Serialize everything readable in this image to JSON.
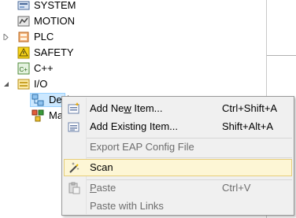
{
  "tree": {
    "items": [
      {
        "label": "SYSTEM",
        "icon": "system-icon"
      },
      {
        "label": "MOTION",
        "icon": "motion-icon"
      },
      {
        "label": "PLC",
        "icon": "plc-icon"
      },
      {
        "label": "SAFETY",
        "icon": "safety-icon"
      },
      {
        "label": "C++",
        "icon": "cpp-icon"
      },
      {
        "label": "I/O",
        "icon": "io-icon"
      },
      {
        "label": "Devi",
        "icon": "devices-icon"
      },
      {
        "label": "Ma",
        "icon": "mappings-icon"
      }
    ]
  },
  "context_menu": {
    "items": [
      {
        "pre": "Add Ne",
        "ul": "w",
        "post": " Item...",
        "shortcut": "Ctrl+Shift+A",
        "enabled": true,
        "icon": "add-new-item-icon"
      },
      {
        "pre": "Add Existing Item...",
        "ul": "",
        "post": "",
        "shortcut": "Shift+Alt+A",
        "enabled": true,
        "icon": "add-existing-item-icon"
      },
      {
        "pre": "Export EAP Config File",
        "ul": "",
        "post": "",
        "shortcut": "",
        "enabled": false,
        "icon": ""
      },
      {
        "pre": "Scan",
        "ul": "",
        "post": "",
        "shortcut": "",
        "enabled": true,
        "highlighted": true,
        "icon": "magic-wand-icon"
      },
      {
        "pre": "",
        "ul": "P",
        "post": "aste",
        "shortcut": "Ctrl+V",
        "enabled": false,
        "icon": "paste-icon"
      },
      {
        "pre": "Paste with Links",
        "ul": "",
        "post": "",
        "shortcut": "",
        "enabled": false,
        "icon": ""
      }
    ]
  },
  "colors": {
    "selection": "#cce8ff",
    "highlight": "#fdf6d5",
    "menu_bg": "#f0f0f0",
    "disabled_text": "#6d6d6d"
  }
}
